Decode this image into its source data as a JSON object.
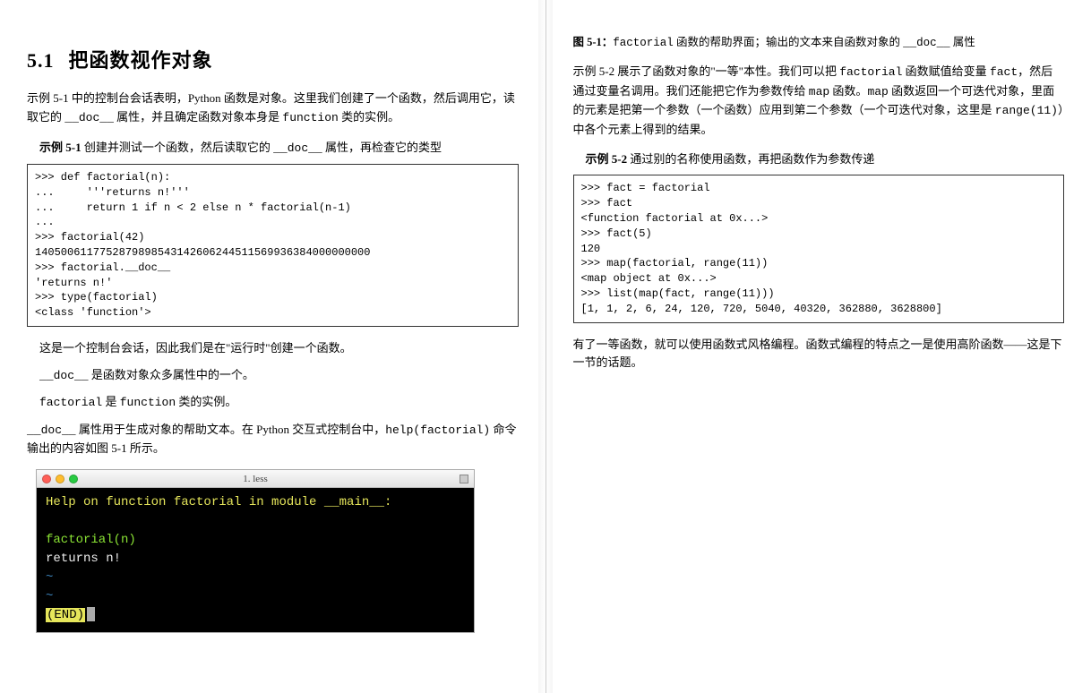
{
  "left": {
    "section_number": "5.1",
    "section_title": "把函数视作对象",
    "intro_para_prefix": "示例 5-1 中的控制台会话表明，Python 函数是对象。这里我们创建了一个函数，然后调用它，读取它的 ",
    "intro_doc": "__doc__",
    "intro_para_mid": " 属性，并且确定函数对象本身是 ",
    "intro_function": "function",
    "intro_para_suffix": " 类的实例。",
    "example1_label": "示例 5-1",
    "example1_desc_prefix": "   创建并测试一个函数，然后读取它的 ",
    "example1_doc": "__doc__",
    "example1_desc_suffix": " 属性，再检查它的类型",
    "code1": ">>> def factorial(n):\n...     '''returns n!'''\n...     return 1 if n < 2 else n * factorial(n-1)\n...\n>>> factorial(42)\n1405006117752879898543142606244511569936384000000000\n>>> factorial.__doc__\n'returns n!'\n>>> type(factorial)\n<class 'function'>",
    "note1": "这是一个控制台会话，因此我们是在\"运行时\"创建一个函数。",
    "note2_prefix": "",
    "note2_doc": "__doc__",
    "note2_suffix": " 是函数对象众多属性中的一个。",
    "note3_prefix": "",
    "note3_factorial": "factorial",
    "note3_mid": " 是 ",
    "note3_function": "function",
    "note3_suffix": " 类的实例。",
    "doc_para_prefix": "",
    "doc_para_doc": "__doc__",
    "doc_para_mid": " 属性用于生成对象的帮助文本。在 Python 交互式控制台中，",
    "doc_para_help": "help(factorial)",
    "doc_para_suffix": " 命令输出的内容如图 5-1 所示。",
    "terminal": {
      "title": "1. less",
      "line1": "Help on function factorial in module __main__:",
      "line2": "factorial(n)",
      "line3": "    returns n!",
      "tilde": "~",
      "end": "(END)"
    }
  },
  "right": {
    "figure_label": "图 5-1：",
    "figure_desc_prefix": "",
    "figure_desc_factorial": "factorial",
    "figure_desc_mid": " 函数的帮助界面；输出的文本来自函数对象的 ",
    "figure_desc_doc": "__doc__",
    "figure_desc_suffix": " 属性",
    "para2_prefix": "示例 5-2 展示了函数对象的\"一等\"本性。我们可以把 ",
    "para2_factorial": "factorial",
    "para2_mid1": " 函数赋值给变量 ",
    "para2_fact": "fact",
    "para2_mid2": "，然后通过变量名调用。我们还能把它作为参数传给 ",
    "para2_map1": "map",
    "para2_mid3": " 函数。",
    "para2_map2": "map",
    "para2_mid4": " 函数返回一个可迭代对象，里面的元素是把第一个参数（一个函数）应用到第二个参数（一个可迭代对象，这里是 ",
    "para2_range": "range(11)",
    "para2_suffix": "）中各个元素上得到的结果。",
    "example2_label": "示例 5-2",
    "example2_desc": "   通过别的名称使用函数，再把函数作为参数传递",
    "code2": ">>> fact = factorial\n>>> fact\n<function factorial at 0x...>\n>>> fact(5)\n120\n>>> map(factorial, range(11))\n<map object at 0x...>\n>>> list(map(fact, range(11)))\n[1, 1, 2, 6, 24, 120, 720, 5040, 40320, 362880, 3628800]",
    "para3": "有了一等函数，就可以使用函数式风格编程。函数式编程的特点之一是使用高阶函数——这是下一节的话题。"
  }
}
